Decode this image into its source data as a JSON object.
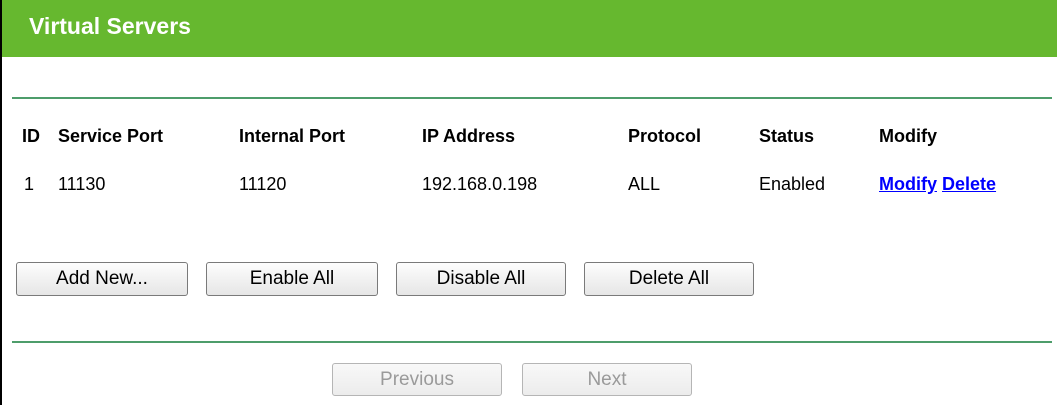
{
  "header": {
    "title": "Virtual Servers"
  },
  "table": {
    "columns": [
      "ID",
      "Service Port",
      "Internal Port",
      "IP Address",
      "Protocol",
      "Status",
      "Modify"
    ],
    "rows": [
      {
        "id": "1",
        "service_port": "11130",
        "internal_port": "11120",
        "ip_address": "192.168.0.198",
        "protocol": "ALL",
        "status": "Enabled",
        "modify_label": "Modify",
        "delete_label": "Delete"
      }
    ]
  },
  "actions": {
    "add_new": "Add New...",
    "enable_all": "Enable All",
    "disable_all": "Disable All",
    "delete_all": "Delete All"
  },
  "pagination": {
    "previous": "Previous",
    "next": "Next"
  },
  "colors": {
    "header_bg": "#66b82f",
    "divider": "#4e9d6b",
    "link": "#0000ff"
  }
}
